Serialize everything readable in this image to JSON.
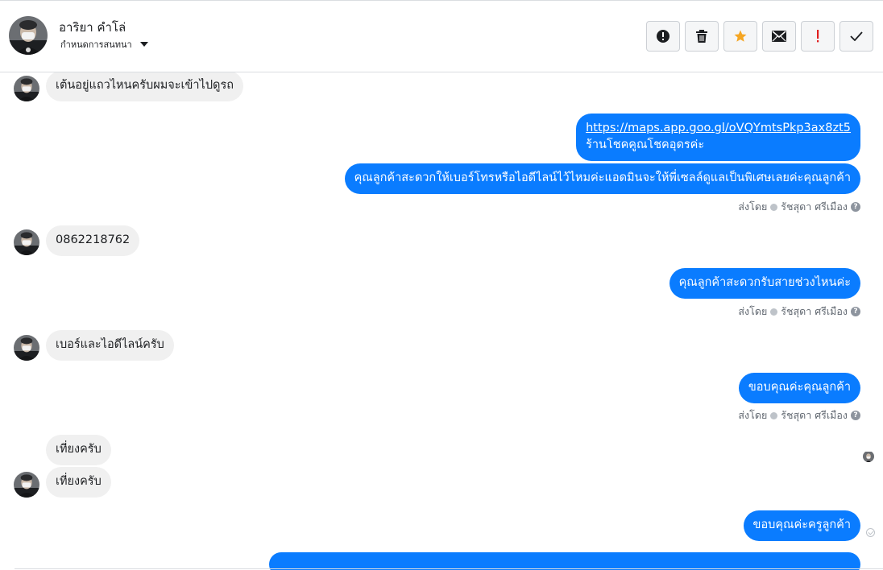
{
  "header": {
    "contact_name": "อาริยา คำโล่",
    "assign_label": "กำหนดการสนทนา",
    "actions": [
      {
        "name": "mark-spam",
        "icon": "exclamation-circle-icon"
      },
      {
        "name": "delete",
        "icon": "trash-icon"
      },
      {
        "name": "star",
        "icon": "star-icon"
      },
      {
        "name": "mark-unread",
        "icon": "envelope-icon"
      },
      {
        "name": "follow-up",
        "icon": "exclamation-icon"
      },
      {
        "name": "mark-done",
        "icon": "check-icon"
      }
    ]
  },
  "colors": {
    "outgoing_bubble": "#0a7cff",
    "incoming_bubble": "#f0f0f0",
    "star": "#f5a623",
    "follow_up": "#e02020"
  },
  "messages": [
    {
      "direction": "in",
      "text": "เต้นอยู่แถวไหนครับผมจะเข้าไปดูรถ"
    },
    {
      "direction": "out",
      "link": "https://maps.app.goo.gl/oVQYmtsPkp3ax8zt5",
      "text": "ร้านโชคคูณโชคอุดรค่ะ"
    },
    {
      "direction": "out",
      "text": "คุณลูกค้าสะดวกให้เบอร์โทรหรือไอดีไลน์ไว้ไหมค่ะแอดมินจะให้พี่เซลล์ดูแลเป็นพิเศษเลยค่ะคุณลูกค้า"
    },
    {
      "direction": "in",
      "text": "0862218762"
    },
    {
      "direction": "out",
      "text": "คุณลูกค้าสะดวกรับสายช่วงไหนค่ะ"
    },
    {
      "direction": "in",
      "text": "เบอร์และไอดีไลน์ครับ"
    },
    {
      "direction": "out",
      "text": "ขอบคุณค่ะคุณลูกค้า"
    },
    {
      "direction": "in",
      "text": "เที่ยงครับ"
    },
    {
      "direction": "in",
      "text": "เที่ยงครับ"
    },
    {
      "direction": "out",
      "text": "ขอบคุณค่ะครูลูกค้า"
    }
  ],
  "sent_by": {
    "prefix": "ส่งโดย",
    "agent": "รัชสุดา ศรีเมือง"
  }
}
